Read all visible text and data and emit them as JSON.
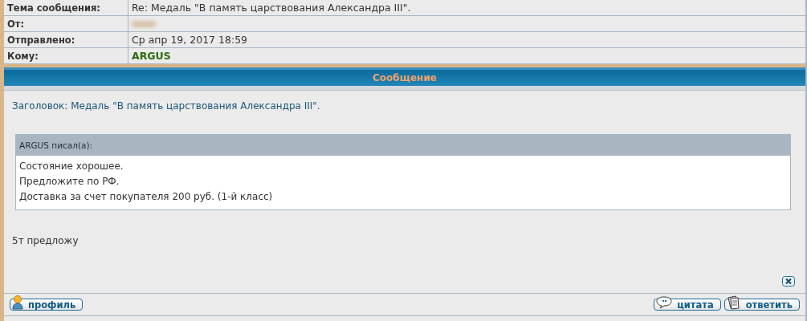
{
  "header_rows": [
    {
      "label": "Тема сообщения:",
      "value": "Re: Медаль \"В память царствования Александра III\".",
      "kind": "text"
    },
    {
      "label": "От:",
      "kind": "blurred"
    },
    {
      "label": "Отправлено:",
      "value": "Ср апр 19, 2017 18:59",
      "kind": "text"
    },
    {
      "label": "Кому:",
      "value": "ARGUS",
      "kind": "user"
    }
  ],
  "section_title": "Сообщение",
  "message": {
    "subject": "Заголовок: Медаль \"В память царствования Александра III\".",
    "quote": {
      "author": "ARGUS писал(а):",
      "lines": [
        "Состояние хорошее.",
        "Предложите по РФ.",
        "Доставка за счет покупателя 200 руб. (1-й класс)"
      ]
    },
    "body": "5т предложу"
  },
  "buttons_left": [
    {
      "label": "профиль",
      "kind": "profile"
    }
  ],
  "buttons_right": [
    {
      "label": "цитата",
      "kind": "quote"
    },
    {
      "label": "ответить",
      "kind": "reply"
    }
  ]
}
